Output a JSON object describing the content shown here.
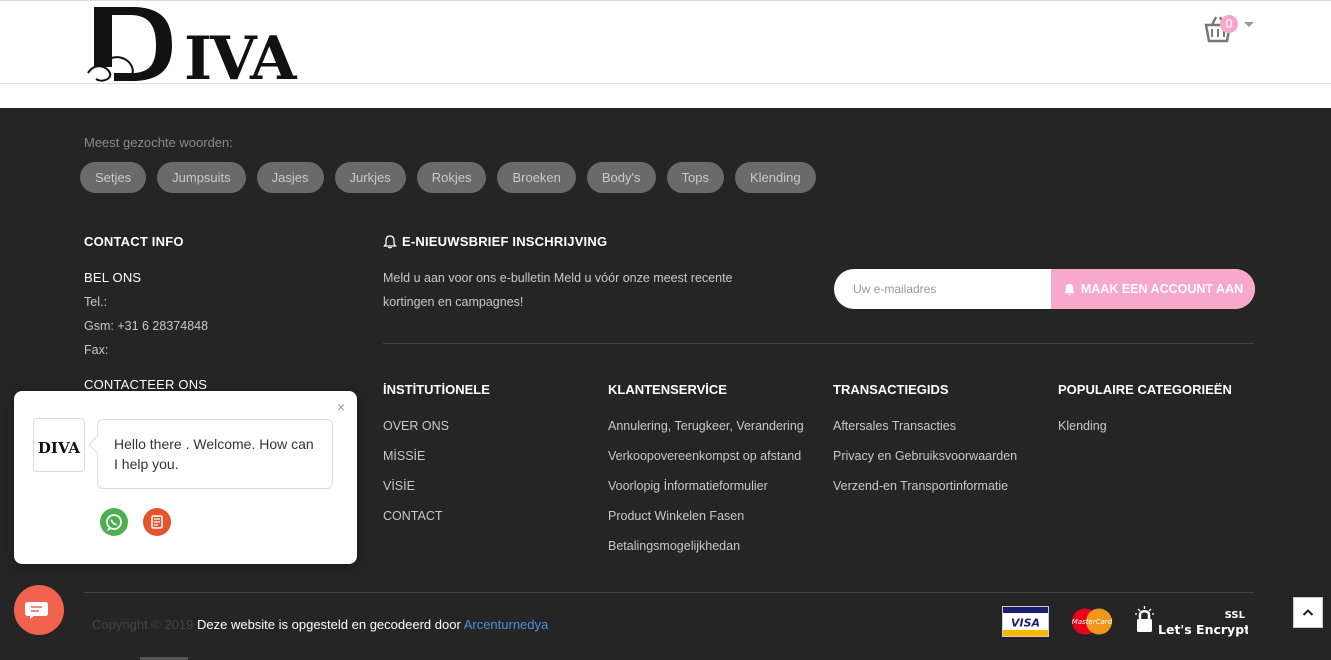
{
  "header": {
    "logo_text": "DIVA",
    "cart": {
      "count": "0"
    }
  },
  "keywords": {
    "label": "Meest gezochte woorden:",
    "items": [
      "Setjes",
      "Jumpsuits",
      "Jasjes",
      "Jurkjes",
      "Rokjes",
      "Broeken",
      "Body's",
      "Tops",
      "Klending"
    ]
  },
  "contact": {
    "title": "CONTACT INFO",
    "bel_title": "BEL ONS",
    "tel": "Tel.:",
    "gsm": "Gsm: +31 6 28374848",
    "fax": "Fax:",
    "contacteer": "CONTACTEER ONS"
  },
  "newsletter": {
    "title": "E-NIEUWSBRIEF INSCHRIJVING",
    "text": "Meld u aan voor ons e-bulletin Meld u vóór onze meest recente kortingen en campagnes!",
    "placeholder": "Uw e-mailadres",
    "button": "MAAK EEN ACCOUNT AAN"
  },
  "columns": [
    {
      "title": "İNSTİTUTİONELE",
      "items": [
        "OVER ONS",
        "MİSSİE",
        "VİSİE",
        "CONTACT"
      ]
    },
    {
      "title": "KLANTENSERVİCE",
      "items": [
        "Annulering, Terugkeer, Verandering",
        "Verkoopovereenkompst op afstand",
        "Voorlopig İnformatieformulier",
        "Product Winkelen Fasen",
        "Betalingsmogelijkhedan"
      ]
    },
    {
      "title": "TRANSACTIEGIDS",
      "items": [
        "Aftersales Transacties",
        "Privacy en Gebruiksvoorwaarden",
        "Verzend-en Transportinformatie"
      ]
    },
    {
      "title": "POPULAIRE CATEGORIEËN",
      "items": [
        "Klending"
      ]
    }
  ],
  "bottom": {
    "copyright": "Copyright © 2019",
    "made_by": "Deze website is opgesteld en gecodeerd door",
    "agency": "Arcenturnedya",
    "visa": "VISA",
    "mastercard": "MasterCard",
    "ssl": "SSL",
    "letsencrypt": "Let's Encrypt"
  },
  "chat": {
    "message": "Hello there . Welcome. How can I help you.",
    "close": "×",
    "avatar_text": "DIVA"
  },
  "colors": {
    "footer_bg": "#252525",
    "accent_pink": "#f7a8cb",
    "whatsapp": "#4caf50",
    "phone": "#e6542c",
    "chat_fab": "#f0624d",
    "link": "#4d8fd8"
  }
}
